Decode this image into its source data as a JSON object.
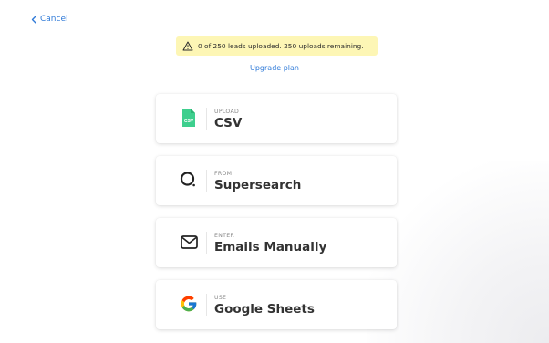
{
  "header": {
    "cancel_label": "Cancel"
  },
  "banner": {
    "text": "0 of 250 leads uploaded.  250 uploads remaining.",
    "icon": "warning-icon"
  },
  "upgrade_label": "Upgrade plan",
  "options": [
    {
      "sub": "UPLOAD",
      "label": "CSV",
      "icon": "csv-file-icon"
    },
    {
      "sub": "FROM",
      "label": "Supersearch",
      "icon": "search-icon"
    },
    {
      "sub": "ENTER",
      "label": "Emails Manually",
      "icon": "mail-icon"
    },
    {
      "sub": "USE",
      "label": "Google Sheets",
      "icon": "google-icon"
    }
  ],
  "colors": {
    "link": "#2f7ad8",
    "banner_bg": "#fdf6b5",
    "csv_green": "#3ecf8e"
  }
}
